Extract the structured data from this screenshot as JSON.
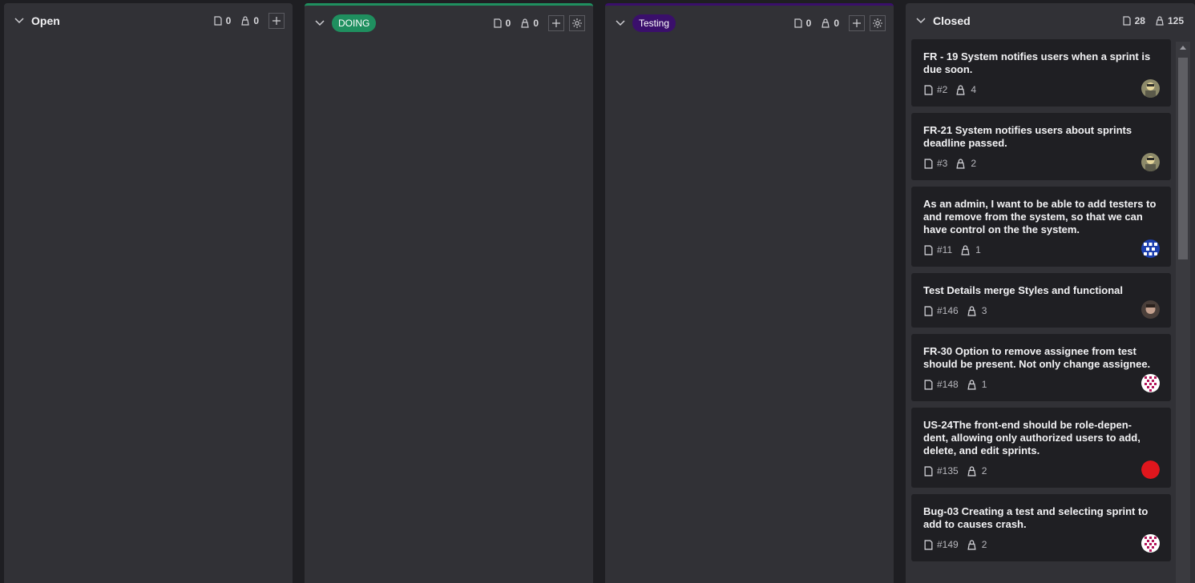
{
  "columns": {
    "open": {
      "title": "Open",
      "tasks": "0",
      "issues": "0"
    },
    "doing": {
      "title": "DOING",
      "tasks": "0",
      "issues": "0",
      "color": "#1f8f5f"
    },
    "testing": {
      "title": "Testing",
      "tasks": "0",
      "issues": "0",
      "color": "#3a0f6b"
    },
    "closed": {
      "title": "Closed",
      "tasks": "28",
      "issues": "125",
      "cards": [
        {
          "title": "FR - 19 System notifies users when a sprint is due soon.",
          "number": "#2",
          "count": "4",
          "avatar": "avatar-photo"
        },
        {
          "title": "FR-21 System notifies users about sprints deadline passed.",
          "number": "#3",
          "count": "2",
          "avatar": "avatar-photo"
        },
        {
          "title": "As an admin, I want to be able to add testers to and remove from the system, so that we can have control on the the system.",
          "number": "#11",
          "count": "1",
          "avatar": "avatar-pattern-blue"
        },
        {
          "title": "Test Details merge Styles and functional",
          "number": "#146",
          "count": "3",
          "avatar": "avatar-photo-face"
        },
        {
          "title": "FR-30 Option to remove assignee from test should be present. Not only change assignee.",
          "number": "#148",
          "count": "1",
          "avatar": "avatar-pattern-pink"
        },
        {
          "title": "US-24The front-end should be role-depen- dent, allowing only authorized users to add, delete, and edit sprints.",
          "number": "#135",
          "count": "2",
          "avatar": "avatar-red"
        },
        {
          "title": "Bug-03 Creating a test and selecting sprint to add to causes crash.",
          "number": "#149",
          "count": "2",
          "avatar": "avatar-pattern-pink"
        }
      ]
    }
  }
}
